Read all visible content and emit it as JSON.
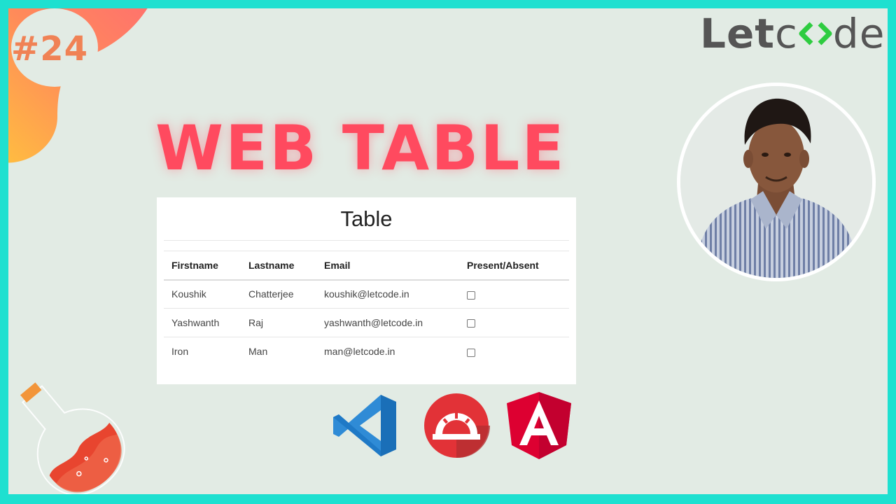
{
  "thumbnail": {
    "episode": "#24",
    "headline": "WEB TABLE"
  },
  "logo": {
    "part1": "Let",
    "part2": "c",
    "part3": "de",
    "icon": "code-brackets-icon",
    "colors": {
      "text": "#555555",
      "green": "#2ecc40"
    }
  },
  "table_card": {
    "title": "Table",
    "headers": [
      "Firstname",
      "Lastname",
      "Email",
      "Present/Absent"
    ],
    "rows": [
      {
        "firstname": "Koushik",
        "lastname": "Chatterjee",
        "email": "koushik@letcode.in",
        "present": false
      },
      {
        "firstname": "Yashwanth",
        "lastname": "Raj",
        "email": "yashwanth@letcode.in",
        "present": false
      },
      {
        "firstname": "Iron",
        "lastname": "Man",
        "email": "man@letcode.in",
        "present": false
      }
    ]
  },
  "icons": {
    "avatar": "presenter-avatar",
    "tools": [
      "vscode-icon",
      "protractor-icon",
      "angular-icon"
    ],
    "decor": [
      "flask-icon"
    ]
  },
  "colors": {
    "border": "#1ee0d0",
    "background": "#e2ebe4",
    "headline": "#ff4a5f",
    "episode": "#f08255"
  }
}
